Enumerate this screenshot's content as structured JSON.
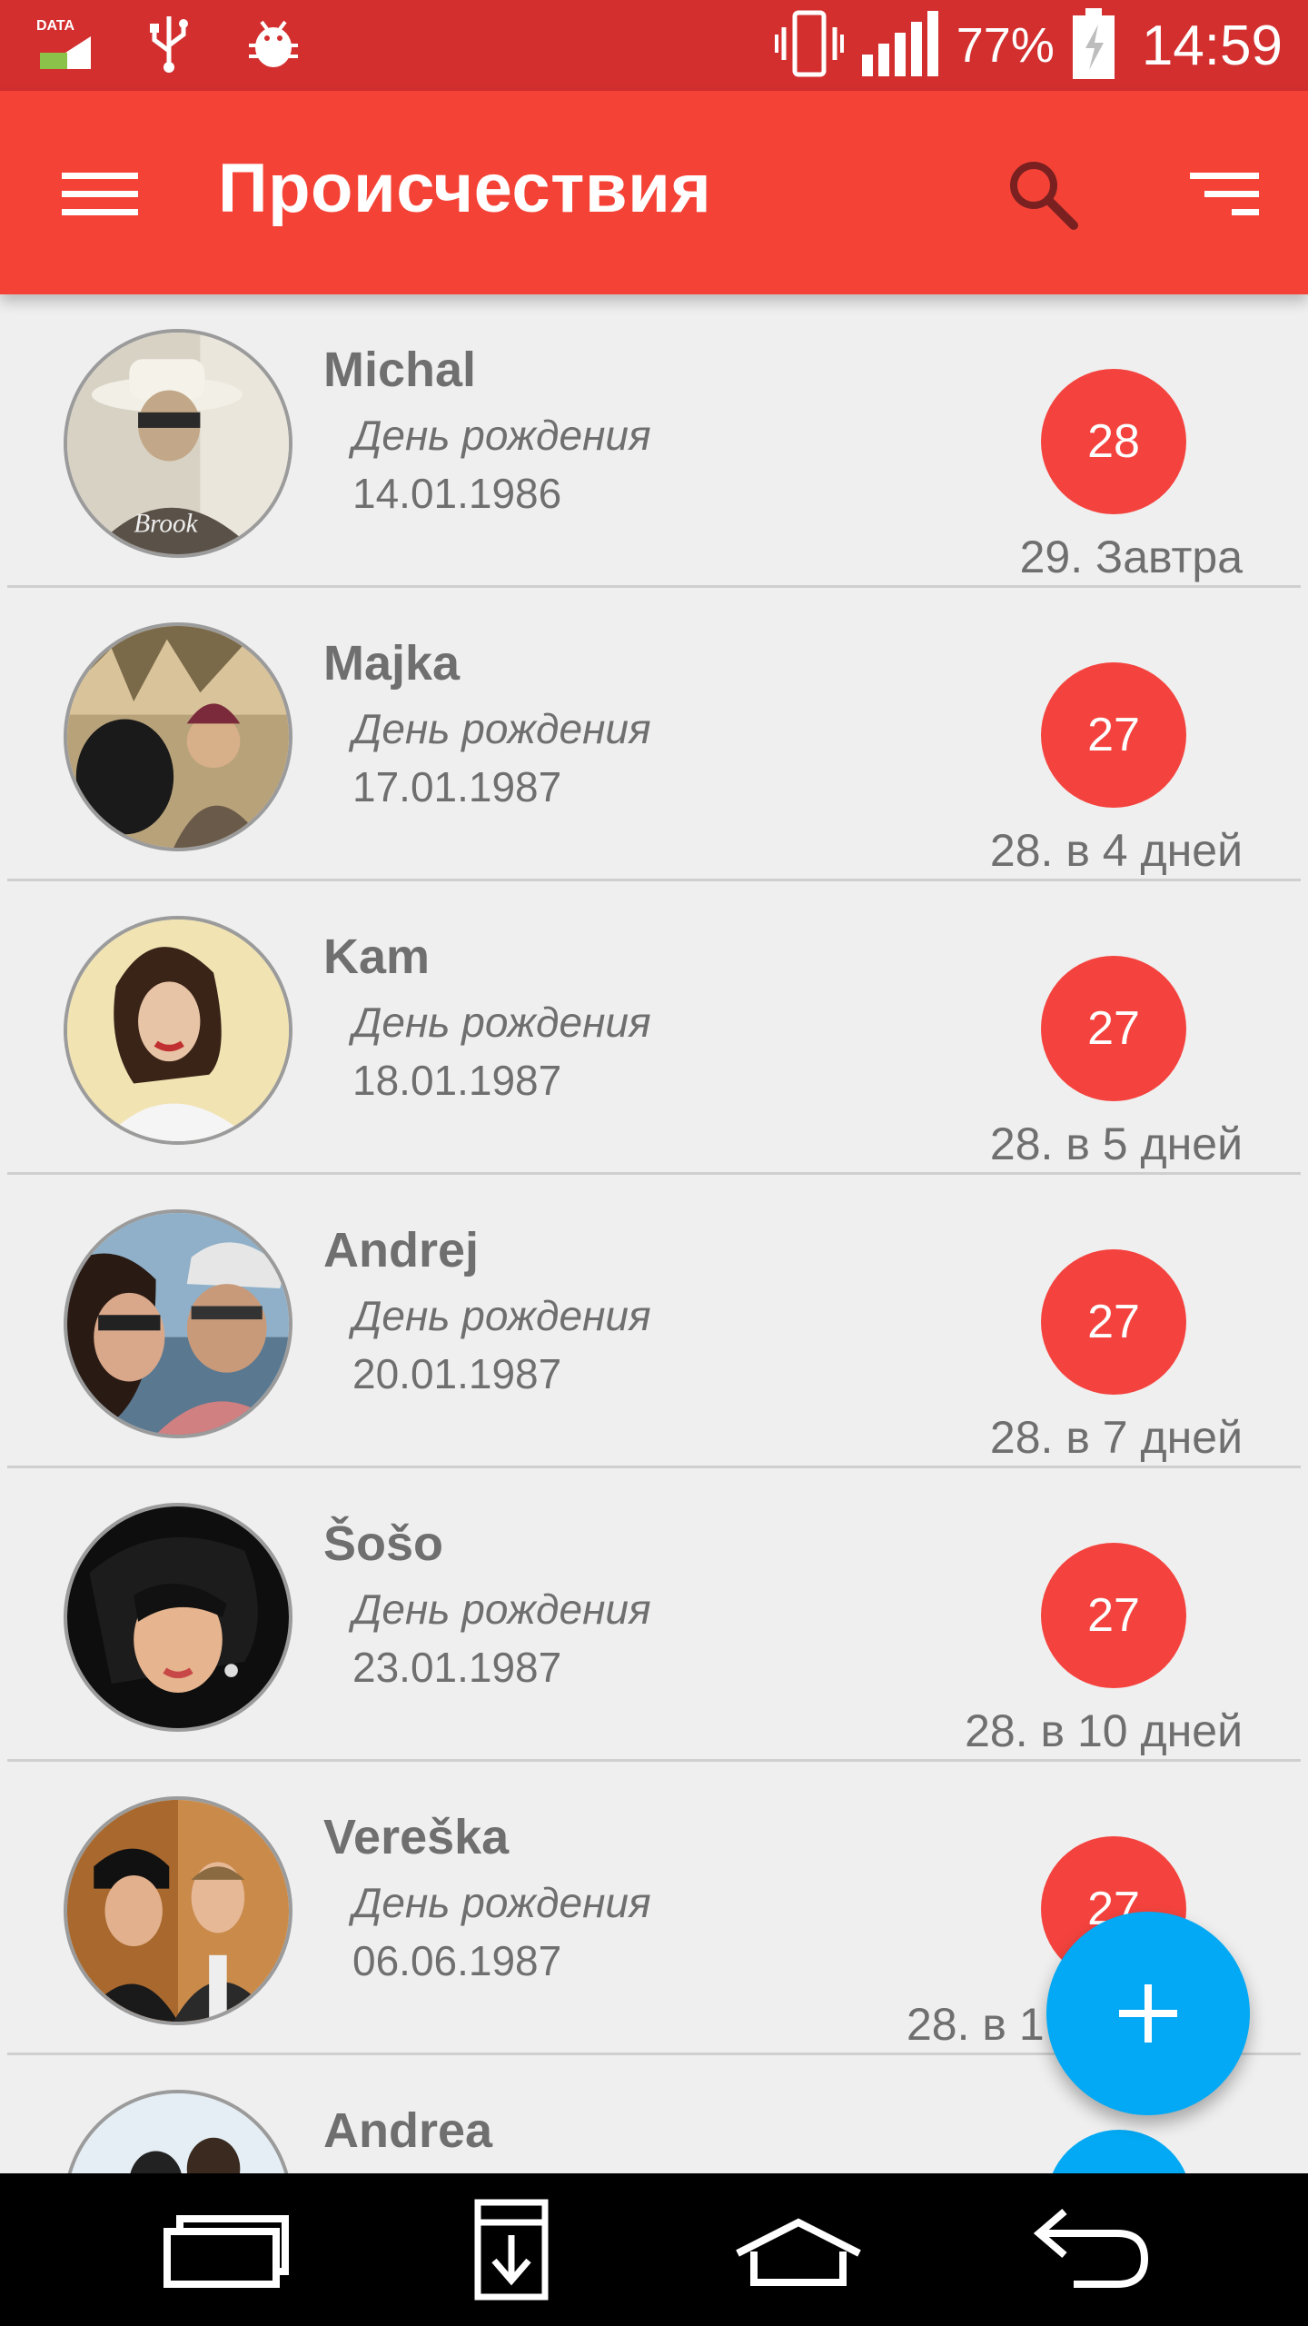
{
  "status_bar": {
    "data_label": "DATA",
    "battery_percent": "77%",
    "time": "14:59",
    "color": "#d32f2f",
    "icons": [
      "data-icon",
      "usb-icon",
      "android-debug-icon",
      "vibrate-icon",
      "signal-icon",
      "battery-icon"
    ]
  },
  "app_bar": {
    "title": "Происчествия",
    "color": "#f44336",
    "icons": [
      "menu-icon",
      "search-icon",
      "sort-icon"
    ]
  },
  "events": [
    {
      "name": "Michal",
      "event": "День рождения",
      "date": "14.01.1986",
      "age": "28",
      "countdown": "29. Завтра"
    },
    {
      "name": "Majka",
      "event": "День рождения",
      "date": "17.01.1987",
      "age": "27",
      "countdown": "28. в 4 дней"
    },
    {
      "name": "Kam",
      "event": "День рождения",
      "date": "18.01.1987",
      "age": "27",
      "countdown": "28. в 5 дней"
    },
    {
      "name": "Andrej",
      "event": "День рождения",
      "date": "20.01.1987",
      "age": "27",
      "countdown": "28. в 7 дней"
    },
    {
      "name": "Šošo",
      "event": "День рождения",
      "date": "23.01.1987",
      "age": "27",
      "countdown": "28. в 10 дней"
    },
    {
      "name": "Vereška",
      "event": "День рождения",
      "date": "06.06.1987",
      "age": "27",
      "countdown": "28. в 1"
    },
    {
      "name": "Andrea",
      "event": "",
      "date": "",
      "age": "",
      "countdown": ""
    }
  ],
  "badge_color": "#f4433e",
  "fab": {
    "icon": "plus-icon",
    "color": "#03a9f4"
  },
  "nav_bar": {
    "icons": [
      "recent-apps-icon",
      "download-icon",
      "home-icon",
      "back-icon"
    ]
  }
}
